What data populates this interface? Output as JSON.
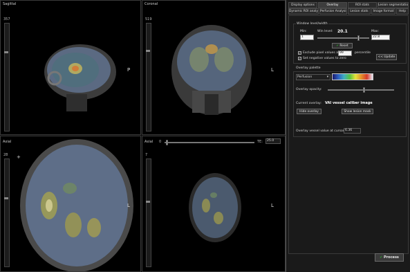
{
  "viewports": {
    "sagittal": {
      "title": "Sagittal",
      "slice": "357",
      "orient_right": "P"
    },
    "coronal": {
      "title": "Coronal",
      "slice": "519",
      "orient_right": "L"
    },
    "axial1": {
      "title": "Axial",
      "slice": "28",
      "orient_right": "L",
      "crosshair": "+"
    },
    "axial2": {
      "title": "Axial",
      "slice": "7",
      "orient_right": "L",
      "time_value": "0",
      "te_label": "TE:",
      "te_value": "25.0"
    }
  },
  "panel": {
    "tabs_row1": [
      "Display options",
      "Overlay",
      "ROI stats",
      "Lesion segmentation"
    ],
    "tabs_row2": [
      "Dynamic ROI analysis",
      "Perfusion Analysis",
      "Lesion stats",
      "Image format",
      "Help"
    ],
    "active_tab": "Overlay",
    "window": {
      "title": "Window level/width",
      "min_label": "Min:",
      "min_value": "1",
      "winlevel_label": "Win level:",
      "winlevel_value": "20.1",
      "max_label": "Max:",
      "max_value": "22.8",
      "reset_label": "Reset",
      "exclude_label": "Exclude pixel values above",
      "exclude_value": "99",
      "percentile_label": "percentile",
      "negative_label": "Set negative values to zero",
      "update_label": "<< Update"
    },
    "palette": {
      "title": "Overlay palette",
      "selected": "Perfusion",
      "opacity_label": "Overlay opacity:",
      "opacity": 0.55
    },
    "current": {
      "label": "Current overlay:",
      "value": "VAI vessel caliber image",
      "hide_label": "Hide overlay",
      "mask_label": "Show lesion mask",
      "cursor_label": "Overlay vessel value at cursor:",
      "cursor_value": "6.36"
    },
    "process_label": "Process"
  },
  "colors": {
    "accent": "#2aa52a",
    "panel": "#1a1a1a"
  }
}
